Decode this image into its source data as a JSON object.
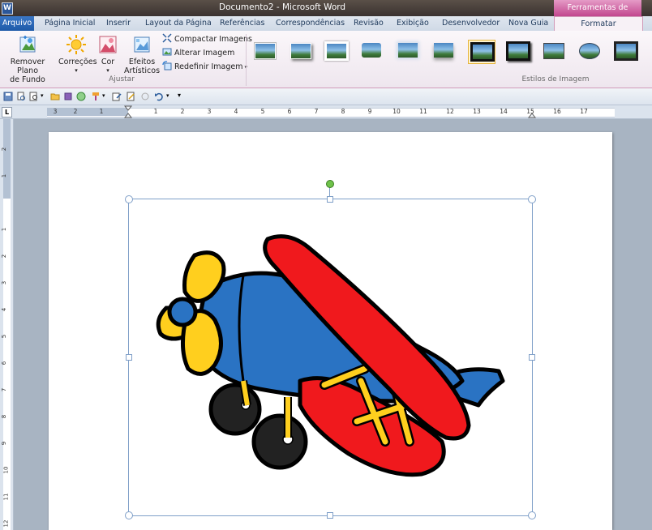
{
  "window": {
    "title": "Documento2 - Microsoft Word",
    "app_icon_letter": "W"
  },
  "ribbon_tabs": {
    "file": "Arquivo",
    "items": [
      "Página Inicial",
      "Inserir",
      "Layout da Página",
      "Referências",
      "Correspondências",
      "Revisão",
      "Exibição",
      "Desenvolvedor",
      "Nova Guia"
    ],
    "context_group": "Ferramentas de Imagem",
    "active": "Formatar"
  },
  "ajustar": {
    "remove_bg": "Remover Plano\nde Fundo",
    "correcoes": "Correções",
    "cor": "Cor",
    "efeitos": "Efeitos\nArtísticos",
    "compactar": "Compactar Imagens",
    "alterar": "Alterar Imagem",
    "redefinir": "Redefinir Imagem",
    "group_label": "Ajustar"
  },
  "estilos": {
    "group_label": "Estilos de Imagem",
    "count": 10
  },
  "ruler": {
    "h_labels": [
      "3",
      "2",
      "1",
      "1",
      "2",
      "3",
      "4",
      "5",
      "6",
      "7",
      "8",
      "9",
      "10",
      "11",
      "12",
      "13",
      "14",
      "15",
      "16",
      "17"
    ],
    "v_labels": [
      "2",
      "1",
      "1",
      "2",
      "3",
      "4",
      "5",
      "6",
      "7",
      "8",
      "9",
      "10",
      "11",
      "12"
    ],
    "corner": "L"
  },
  "colors": {
    "selection": "#7f9fc8",
    "rotate_handle": "#6fc24a",
    "airplane_body": "#2a73c3",
    "airplane_wing": "#f0191d",
    "propeller": "#ffcf1e"
  }
}
